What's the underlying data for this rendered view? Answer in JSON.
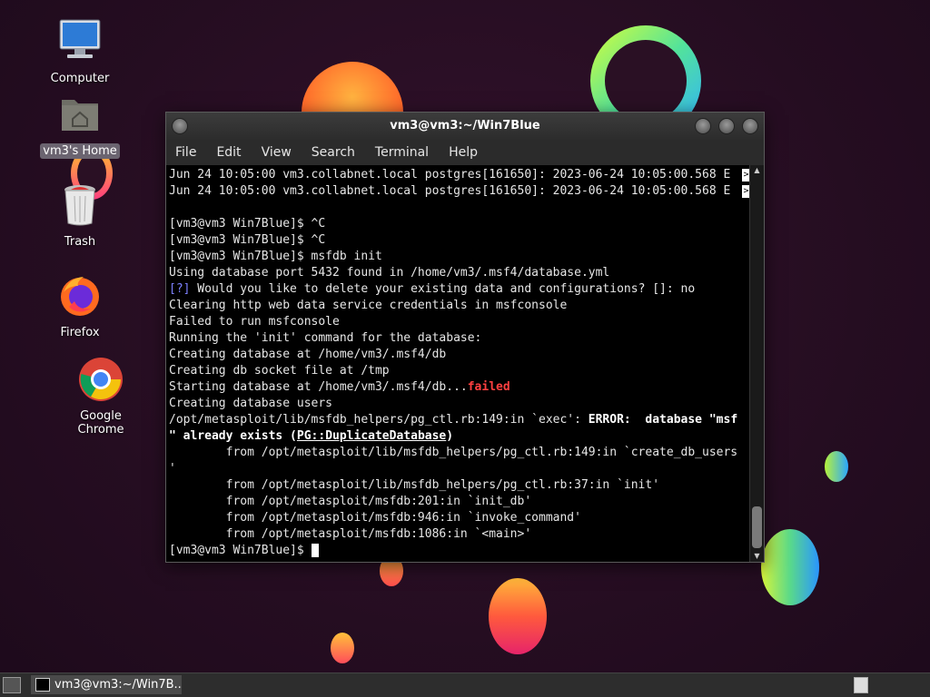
{
  "desktop": {
    "icons": [
      {
        "label": "Computer",
        "icon": "computer-icon"
      },
      {
        "label": "vm3's Home",
        "icon": "home-folder-icon",
        "selected": true
      },
      {
        "label": "Trash",
        "icon": "trash-icon"
      },
      {
        "label": "Firefox",
        "icon": "firefox-icon"
      },
      {
        "label": "Google Chrome",
        "icon": "chrome-icon"
      }
    ]
  },
  "terminal": {
    "title": "vm3@vm3:~/Win7Blue",
    "menu": [
      "File",
      "Edit",
      "View",
      "Search",
      "Terminal",
      "Help"
    ],
    "lines": [
      "Jun 24 10:05:00 vm3.collabnet.local postgres[161650]: 2023-06-24 10:05:00.568 E",
      "Jun 24 10:05:00 vm3.collabnet.local postgres[161650]: 2023-06-24 10:05:00.568 E",
      "",
      "[vm3@vm3 Win7Blue]$ ^C",
      "[vm3@vm3 Win7Blue]$ ^C",
      "[vm3@vm3 Win7Blue]$ msfdb init",
      "Using database port 5432 found in /home/vm3/.msf4/database.yml",
      "[?] Would you like to delete your existing data and configurations? []: no",
      "Clearing http web data service credentials in msfconsole",
      "Failed to run msfconsole",
      "Running the 'init' command for the database:",
      "Creating database at /home/vm3/.msf4/db",
      "Creating db socket file at /tmp",
      "Starting database at /home/vm3/.msf4/db...",
      "failed",
      "Creating database users",
      "/opt/metasploit/lib/msfdb_helpers/pg_ctl.rb:149:in `exec': ",
      "ERROR:  database \"msf",
      "\" already exists (",
      "PG::DuplicateDatabase",
      ")",
      "        from /opt/metasploit/lib/msfdb_helpers/pg_ctl.rb:149:in `create_db_users",
      "'",
      "        from /opt/metasploit/lib/msfdb_helpers/pg_ctl.rb:37:in `init'",
      "        from /opt/metasploit/msfdb:201:in `init_db'",
      "        from /opt/metasploit/msfdb:946:in `invoke_command'",
      "        from /opt/metasploit/msfdb:1086:in `<main>'",
      "[vm3@vm3 Win7Blue]$ "
    ],
    "overflow_marker": ">"
  },
  "taskbar": {
    "window_label": "vm3@vm3:~/Win7B..."
  },
  "colors": {
    "prompt_question": "#7c80ff",
    "failed": "#ff4040"
  }
}
